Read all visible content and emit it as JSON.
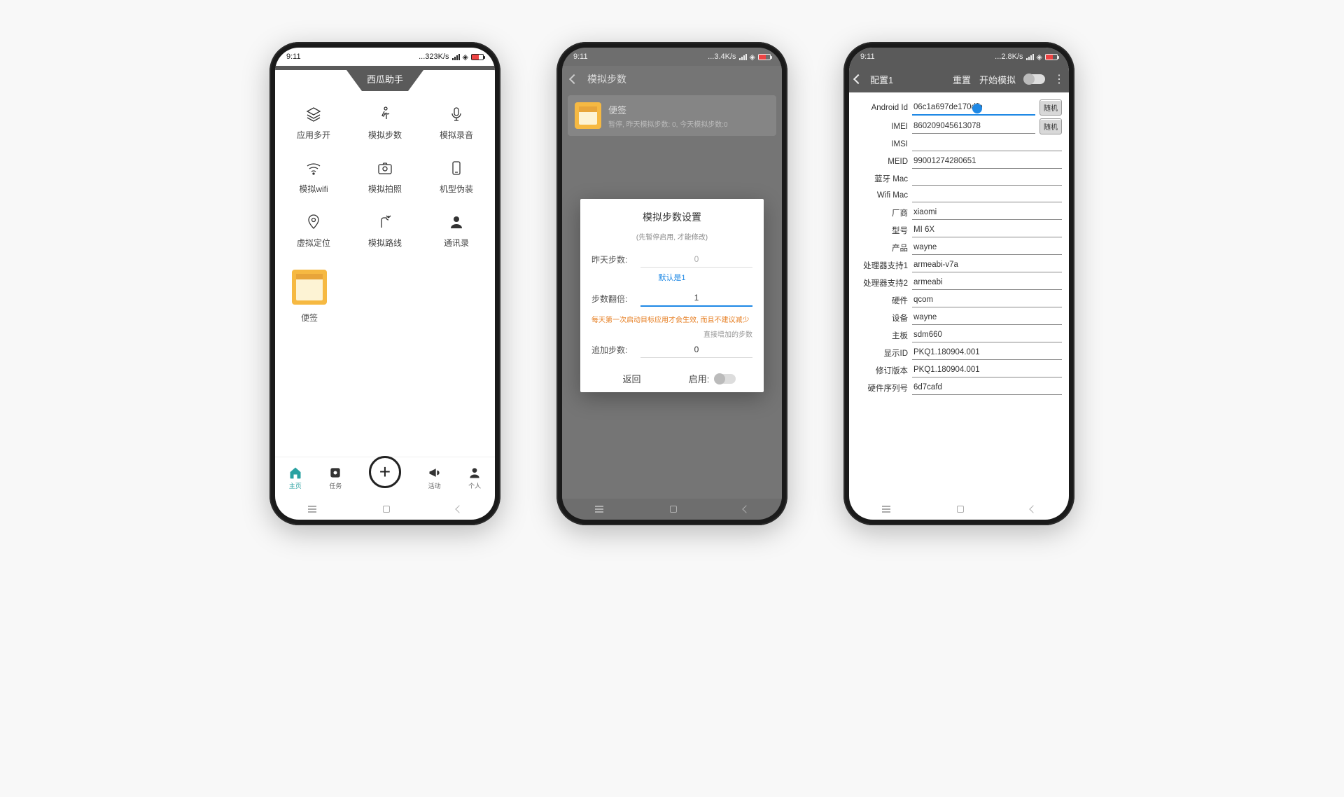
{
  "status": {
    "time": "9:11",
    "speed1": "...323K/s",
    "speed2": "...3.4K/s",
    "speed3": "...2.8K/s",
    "batt": "8"
  },
  "p1": {
    "title": "西瓜助手",
    "grid": [
      {
        "label": "应用多开",
        "icon": "layers"
      },
      {
        "label": "模拟步数",
        "icon": "walk"
      },
      {
        "label": "模拟录音",
        "icon": "mic"
      },
      {
        "label": "模拟wifi",
        "icon": "wifi"
      },
      {
        "label": "模拟拍照",
        "icon": "camera"
      },
      {
        "label": "机型伪装",
        "icon": "phone"
      },
      {
        "label": "虚拟定位",
        "icon": "pin"
      },
      {
        "label": "模拟路线",
        "icon": "route"
      },
      {
        "label": "通讯录",
        "icon": "person"
      }
    ],
    "app": {
      "label": "便签"
    },
    "tabs": [
      {
        "label": "主页"
      },
      {
        "label": "任务"
      },
      {
        "label": ""
      },
      {
        "label": "活动"
      },
      {
        "label": "个人"
      }
    ]
  },
  "p2": {
    "header": "模拟步数",
    "card": {
      "title": "便签",
      "subtitle": "暂停, 昨天模拟步数: 0, 今天模拟步数:0"
    },
    "dialog": {
      "title": "模拟步数设置",
      "hint": "(先暂停启用, 才能修改)",
      "rows": {
        "yesterday_k": "昨天步数:",
        "yesterday_v": "0",
        "mult_k": "步数翻倍:",
        "mult_v": "1",
        "mult_default": "默认是1",
        "warn": "每天第一次启动目标应用才会生效, 而且不建议减少",
        "add_hint": "直接增加的步数",
        "add_k": "追加步数:",
        "add_v": "0"
      },
      "actions": {
        "return": "返回",
        "enable": "启用:"
      }
    }
  },
  "p3": {
    "header": {
      "title": "配置1",
      "reset": "重置",
      "start": "开始模拟"
    },
    "random_btn": "随机",
    "fields": [
      {
        "k": "Android Id",
        "v": "06c1a697de170dfb",
        "rand": true,
        "hi": true
      },
      {
        "k": "IMEI",
        "v": "860209045613078",
        "rand": true
      },
      {
        "k": "IMSI",
        "v": ""
      },
      {
        "k": "MEID",
        "v": "99001274280651"
      },
      {
        "k": "蓝牙 Mac",
        "v": ""
      },
      {
        "k": "Wifi Mac",
        "v": ""
      },
      {
        "k": "厂商",
        "v": "xiaomi"
      },
      {
        "k": "型号",
        "v": "MI 6X"
      },
      {
        "k": "产品",
        "v": "wayne"
      },
      {
        "k": "处理器支持1",
        "v": "armeabi-v7a"
      },
      {
        "k": "处理器支持2",
        "v": "armeabi"
      },
      {
        "k": "硬件",
        "v": "qcom"
      },
      {
        "k": "设备",
        "v": "wayne"
      },
      {
        "k": "主板",
        "v": "sdm660"
      },
      {
        "k": "显示ID",
        "v": "PKQ1.180904.001"
      },
      {
        "k": "修订版本",
        "v": "PKQ1.180904.001"
      },
      {
        "k": "硬件序列号",
        "v": "6d7cafd"
      }
    ]
  }
}
